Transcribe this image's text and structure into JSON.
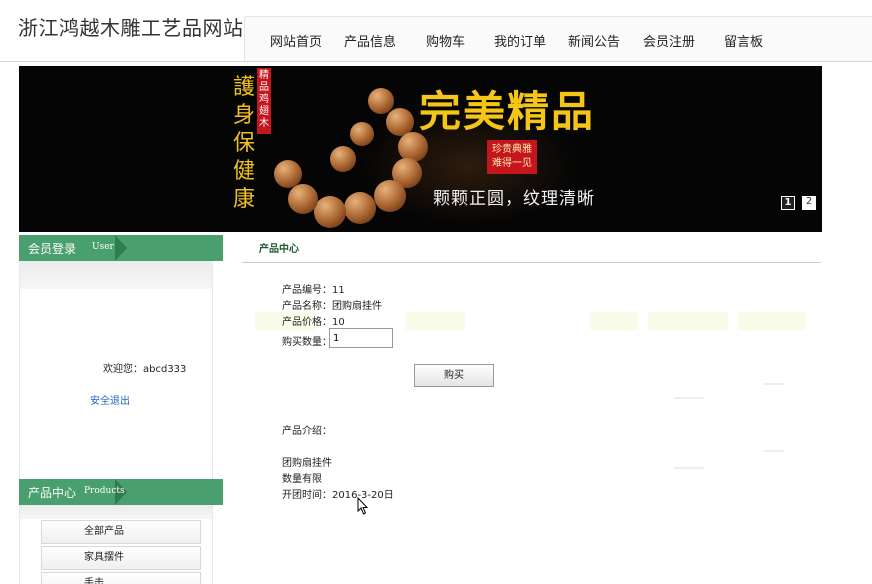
{
  "header": {
    "site_title": "浙江鸿越木雕工艺品网站",
    "nav": [
      {
        "label": "网站首页"
      },
      {
        "label": "产品信息"
      },
      {
        "label": "购物车"
      },
      {
        "label": "我的订单"
      },
      {
        "label": "新闻公告"
      },
      {
        "label": "会员注册"
      },
      {
        "label": "留言板"
      }
    ]
  },
  "banner": {
    "vertical_text": "護身保健康",
    "tag_text": "精品鸡翅木",
    "title": "完美精品",
    "seal_text": "珍贵典雅 难得一见",
    "subtitle": "颗颗正圆，纹理清晰",
    "slides": [
      "1",
      "2"
    ],
    "active_slide": 1
  },
  "sidebar": {
    "login": {
      "title_cn": "会员登录",
      "title_en": "User",
      "welcome_label": "欢迎您：",
      "username": "abcd333",
      "logout_label": "安全退出"
    },
    "products": {
      "title_cn": "产品中心",
      "title_en": "Products",
      "categories": [
        {
          "label": "全部产品"
        },
        {
          "label": "家具摆件"
        },
        {
          "label": "手击"
        }
      ]
    }
  },
  "main": {
    "section_title": "产品中心",
    "product": {
      "id_label": "产品编号：",
      "id_value": "11",
      "name_label": "产品名称：",
      "name_value": "团购扇挂件",
      "price_label": "产品价格：",
      "price_value": "10",
      "qty_label": "购买数量：",
      "qty_value": "1",
      "buy_label": "购买",
      "intro_label": "产品介绍：",
      "intro_lines": [
        "团购扇挂件",
        "数量有限",
        "开团时间：2016-3-20日"
      ]
    }
  },
  "colors": {
    "sidebar_header": "#4a9f6e",
    "sidebar_header_arrow": "#2f7d4f",
    "banner_gold": "#f5c518",
    "banner_red": "#c4161c",
    "link_blue": "#2266bb",
    "section_title": "#1f5a33"
  }
}
